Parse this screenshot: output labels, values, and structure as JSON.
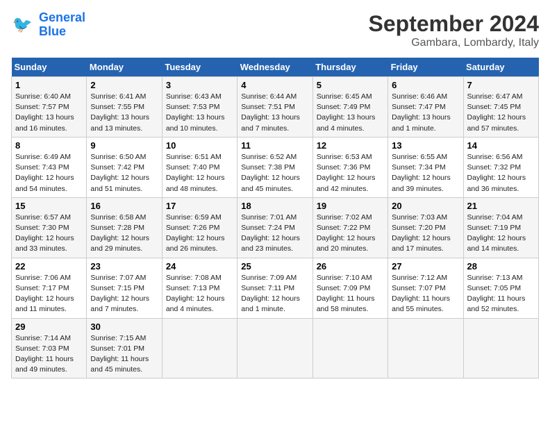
{
  "header": {
    "logo_line1": "General",
    "logo_line2": "Blue",
    "main_title": "September 2024",
    "subtitle": "Gambara, Lombardy, Italy"
  },
  "weekdays": [
    "Sunday",
    "Monday",
    "Tuesday",
    "Wednesday",
    "Thursday",
    "Friday",
    "Saturday"
  ],
  "weeks": [
    [
      {
        "day": "1",
        "info": "Sunrise: 6:40 AM\nSunset: 7:57 PM\nDaylight: 13 hours\nand 16 minutes."
      },
      {
        "day": "2",
        "info": "Sunrise: 6:41 AM\nSunset: 7:55 PM\nDaylight: 13 hours\nand 13 minutes."
      },
      {
        "day": "3",
        "info": "Sunrise: 6:43 AM\nSunset: 7:53 PM\nDaylight: 13 hours\nand 10 minutes."
      },
      {
        "day": "4",
        "info": "Sunrise: 6:44 AM\nSunset: 7:51 PM\nDaylight: 13 hours\nand 7 minutes."
      },
      {
        "day": "5",
        "info": "Sunrise: 6:45 AM\nSunset: 7:49 PM\nDaylight: 13 hours\nand 4 minutes."
      },
      {
        "day": "6",
        "info": "Sunrise: 6:46 AM\nSunset: 7:47 PM\nDaylight: 13 hours\nand 1 minute."
      },
      {
        "day": "7",
        "info": "Sunrise: 6:47 AM\nSunset: 7:45 PM\nDaylight: 12 hours\nand 57 minutes."
      }
    ],
    [
      {
        "day": "8",
        "info": "Sunrise: 6:49 AM\nSunset: 7:43 PM\nDaylight: 12 hours\nand 54 minutes."
      },
      {
        "day": "9",
        "info": "Sunrise: 6:50 AM\nSunset: 7:42 PM\nDaylight: 12 hours\nand 51 minutes."
      },
      {
        "day": "10",
        "info": "Sunrise: 6:51 AM\nSunset: 7:40 PM\nDaylight: 12 hours\nand 48 minutes."
      },
      {
        "day": "11",
        "info": "Sunrise: 6:52 AM\nSunset: 7:38 PM\nDaylight: 12 hours\nand 45 minutes."
      },
      {
        "day": "12",
        "info": "Sunrise: 6:53 AM\nSunset: 7:36 PM\nDaylight: 12 hours\nand 42 minutes."
      },
      {
        "day": "13",
        "info": "Sunrise: 6:55 AM\nSunset: 7:34 PM\nDaylight: 12 hours\nand 39 minutes."
      },
      {
        "day": "14",
        "info": "Sunrise: 6:56 AM\nSunset: 7:32 PM\nDaylight: 12 hours\nand 36 minutes."
      }
    ],
    [
      {
        "day": "15",
        "info": "Sunrise: 6:57 AM\nSunset: 7:30 PM\nDaylight: 12 hours\nand 33 minutes."
      },
      {
        "day": "16",
        "info": "Sunrise: 6:58 AM\nSunset: 7:28 PM\nDaylight: 12 hours\nand 29 minutes."
      },
      {
        "day": "17",
        "info": "Sunrise: 6:59 AM\nSunset: 7:26 PM\nDaylight: 12 hours\nand 26 minutes."
      },
      {
        "day": "18",
        "info": "Sunrise: 7:01 AM\nSunset: 7:24 PM\nDaylight: 12 hours\nand 23 minutes."
      },
      {
        "day": "19",
        "info": "Sunrise: 7:02 AM\nSunset: 7:22 PM\nDaylight: 12 hours\nand 20 minutes."
      },
      {
        "day": "20",
        "info": "Sunrise: 7:03 AM\nSunset: 7:20 PM\nDaylight: 12 hours\nand 17 minutes."
      },
      {
        "day": "21",
        "info": "Sunrise: 7:04 AM\nSunset: 7:19 PM\nDaylight: 12 hours\nand 14 minutes."
      }
    ],
    [
      {
        "day": "22",
        "info": "Sunrise: 7:06 AM\nSunset: 7:17 PM\nDaylight: 12 hours\nand 11 minutes."
      },
      {
        "day": "23",
        "info": "Sunrise: 7:07 AM\nSunset: 7:15 PM\nDaylight: 12 hours\nand 7 minutes."
      },
      {
        "day": "24",
        "info": "Sunrise: 7:08 AM\nSunset: 7:13 PM\nDaylight: 12 hours\nand 4 minutes."
      },
      {
        "day": "25",
        "info": "Sunrise: 7:09 AM\nSunset: 7:11 PM\nDaylight: 12 hours\nand 1 minute."
      },
      {
        "day": "26",
        "info": "Sunrise: 7:10 AM\nSunset: 7:09 PM\nDaylight: 11 hours\nand 58 minutes."
      },
      {
        "day": "27",
        "info": "Sunrise: 7:12 AM\nSunset: 7:07 PM\nDaylight: 11 hours\nand 55 minutes."
      },
      {
        "day": "28",
        "info": "Sunrise: 7:13 AM\nSunset: 7:05 PM\nDaylight: 11 hours\nand 52 minutes."
      }
    ],
    [
      {
        "day": "29",
        "info": "Sunrise: 7:14 AM\nSunset: 7:03 PM\nDaylight: 11 hours\nand 49 minutes."
      },
      {
        "day": "30",
        "info": "Sunrise: 7:15 AM\nSunset: 7:01 PM\nDaylight: 11 hours\nand 45 minutes."
      },
      {
        "day": "",
        "info": ""
      },
      {
        "day": "",
        "info": ""
      },
      {
        "day": "",
        "info": ""
      },
      {
        "day": "",
        "info": ""
      },
      {
        "day": "",
        "info": ""
      }
    ]
  ]
}
